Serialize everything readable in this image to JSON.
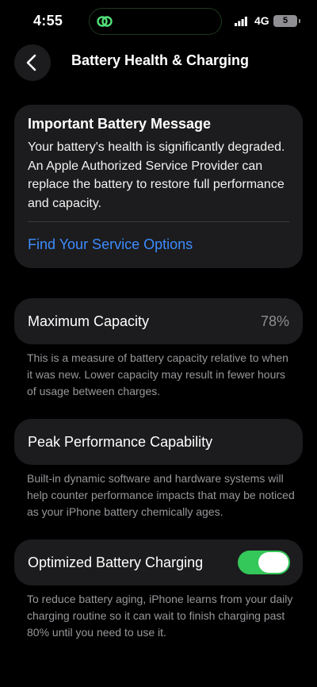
{
  "status_bar": {
    "time": "4:55",
    "network": "4G",
    "battery_level": "5"
  },
  "nav": {
    "title": "Battery Health & Charging"
  },
  "message_card": {
    "title": "Important Battery Message",
    "body": "Your battery's health is significantly degraded. An Apple Authorized Service Provider can replace the battery to restore full performance and capacity.",
    "link_label": "Find Your Service Options"
  },
  "max_capacity": {
    "label": "Maximum Capacity",
    "value": "78%",
    "description": "This is a measure of battery capacity relative to when it was new. Lower capacity may result in fewer hours of usage between charges."
  },
  "peak_performance": {
    "label": "Peak Performance Capability",
    "description": "Built-in dynamic software and hardware systems will help counter performance impacts that may be noticed as your iPhone battery chemically ages."
  },
  "optimized_charging": {
    "label": "Optimized Battery Charging",
    "enabled": true,
    "description": "To reduce battery aging, iPhone learns from your daily charging routine so it can wait to finish charging past 80% until you need to use it."
  },
  "colors": {
    "background": "#000000",
    "card": "#1c1c1e",
    "link": "#3d8bfd",
    "toggle_on": "#34c759",
    "secondary_text": "#98989d"
  }
}
